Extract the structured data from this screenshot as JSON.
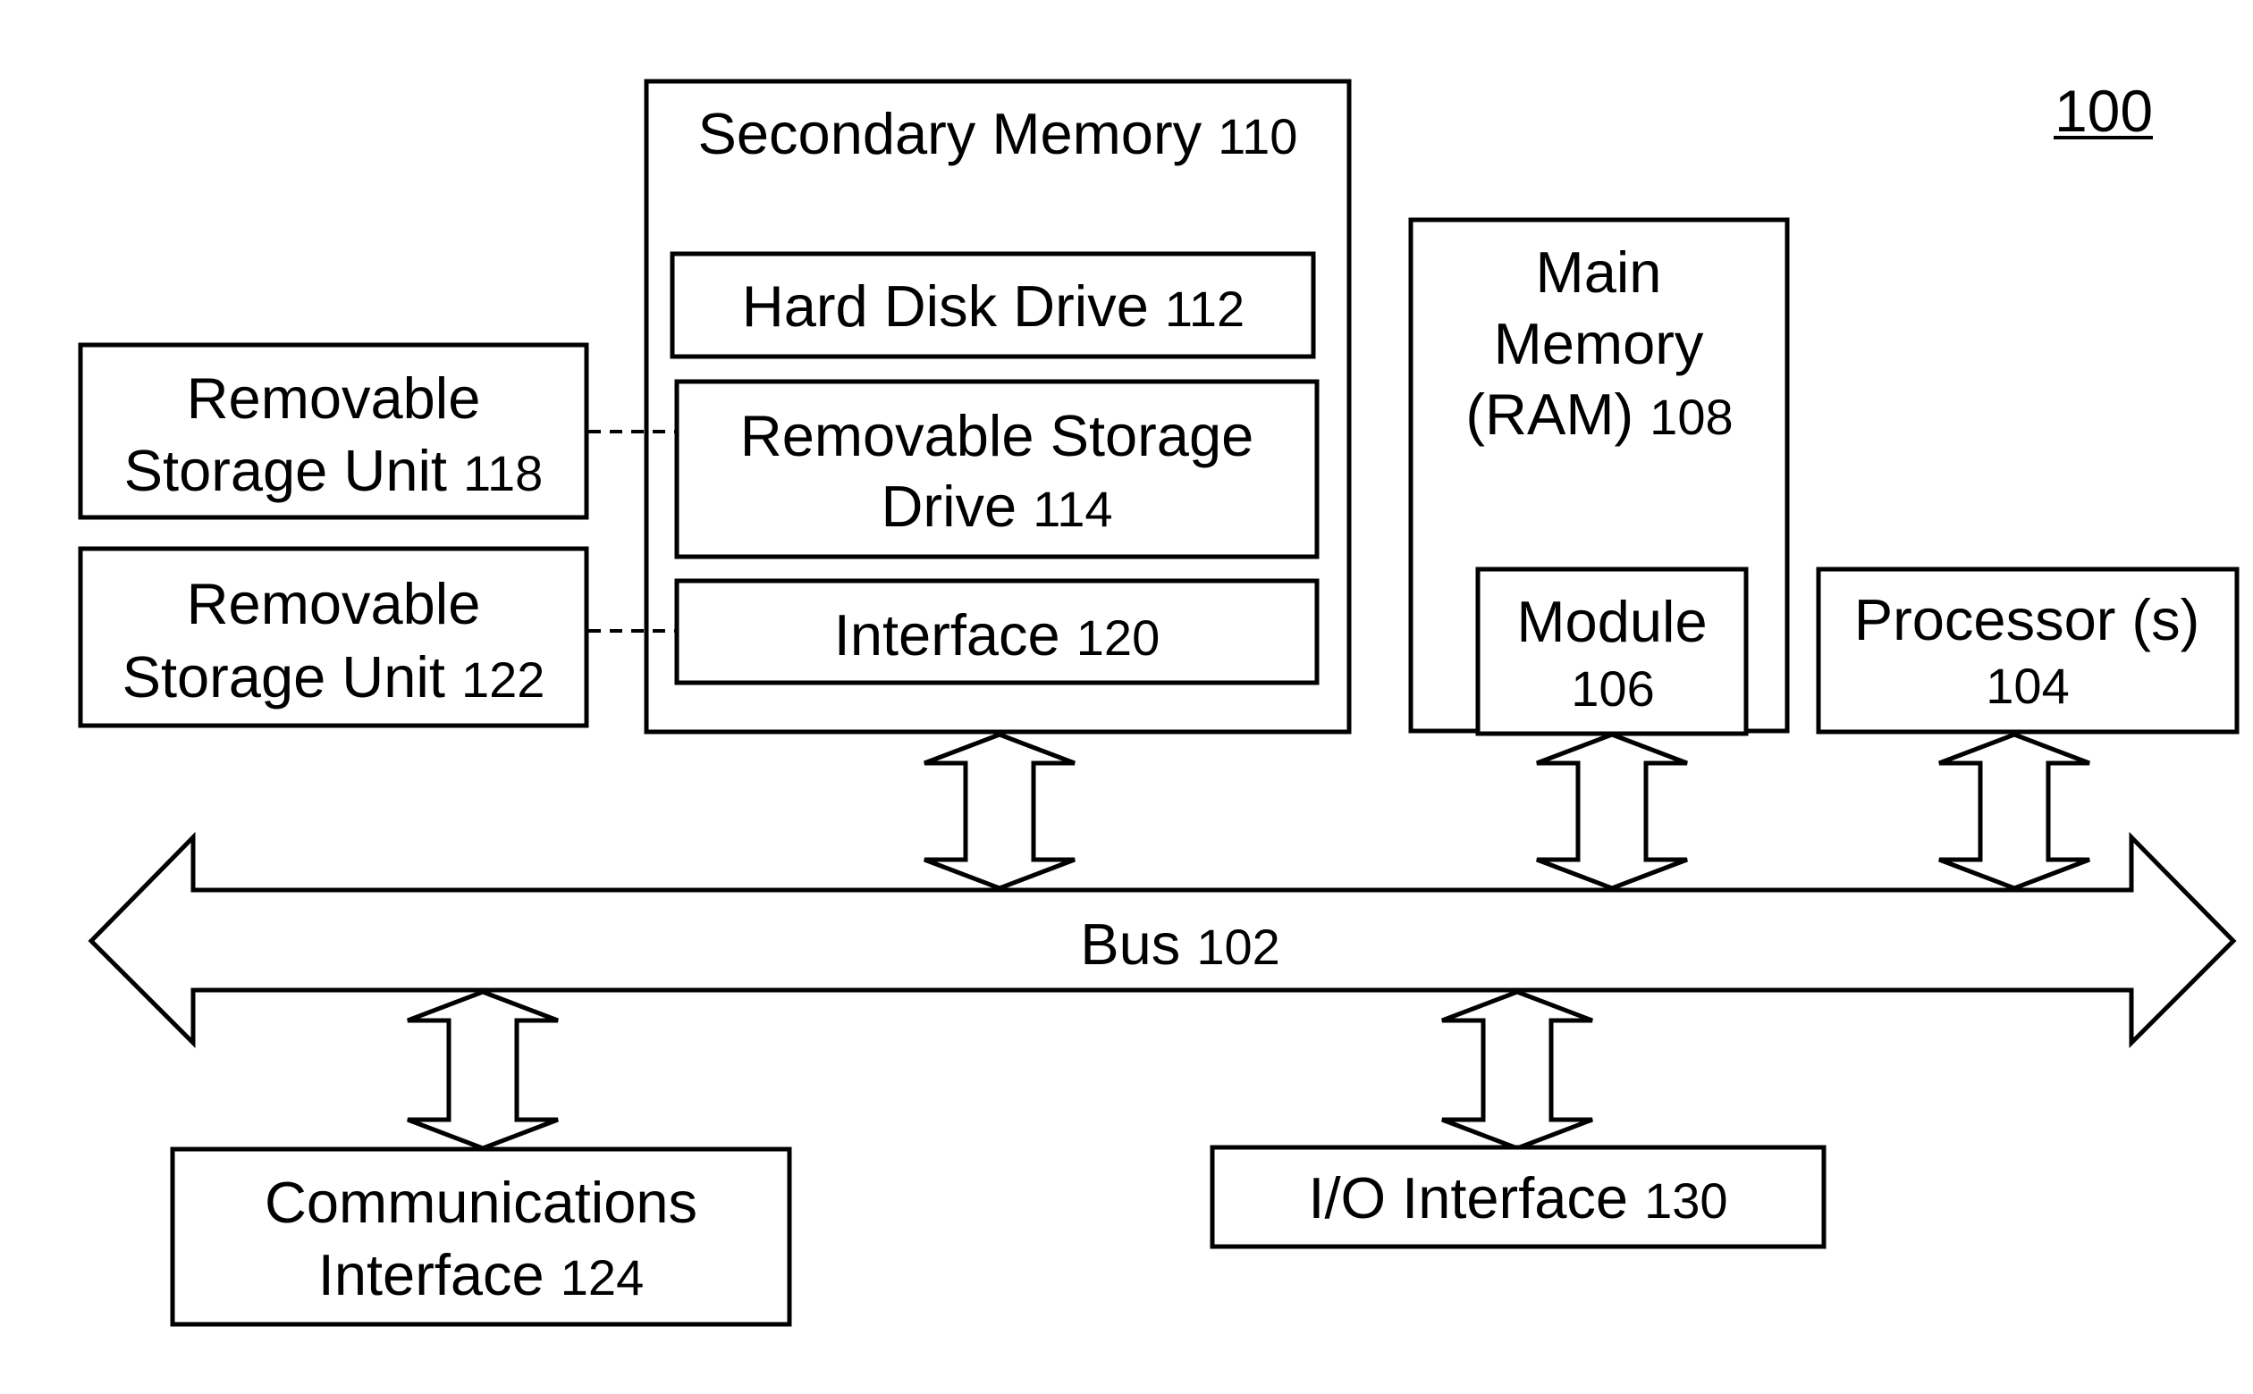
{
  "figure": {
    "reference_number": "100",
    "colors": {
      "stroke": "#000000",
      "background": "#ffffff"
    }
  },
  "components": {
    "secondary_memory": {
      "text": "Secondary Memory",
      "num": "110"
    },
    "hard_disk_drive": {
      "text": "Hard Disk Drive",
      "num": "112"
    },
    "removable_storage_drive": {
      "line1": "Removable Storage",
      "line2_text": "Drive",
      "num": "114"
    },
    "interface": {
      "text": "Interface",
      "num": "120"
    },
    "removable_storage_unit_118": {
      "line1": "Removable",
      "line2_text": "Storage Unit",
      "num": "118"
    },
    "removable_storage_unit_122": {
      "line1": "Removable",
      "line2_text": "Storage Unit",
      "num": "122"
    },
    "main_memory": {
      "line1": "Main",
      "line2": "Memory",
      "line3_text": "(RAM)",
      "num": "108"
    },
    "module": {
      "text": "Module",
      "num": "106"
    },
    "processor": {
      "text": "Processor (s)",
      "num": "104"
    },
    "bus": {
      "text": "Bus",
      "num": "102"
    },
    "communications_interface": {
      "line1": "Communications",
      "line2_text": "Interface",
      "num": "124"
    },
    "io_interface": {
      "text": "I/O Interface",
      "num": "130"
    }
  },
  "connections": [
    {
      "from": "removable_storage_unit_118",
      "to": "removable_storage_drive",
      "style": "dashed"
    },
    {
      "from": "removable_storage_unit_122",
      "to": "interface",
      "style": "dashed"
    },
    {
      "from": "secondary_memory",
      "to": "bus",
      "style": "double-arrow"
    },
    {
      "from": "module",
      "to": "bus",
      "style": "double-arrow"
    },
    {
      "from": "processor",
      "to": "bus",
      "style": "double-arrow"
    },
    {
      "from": "bus",
      "to": "communications_interface",
      "style": "double-arrow"
    },
    {
      "from": "bus",
      "to": "io_interface",
      "style": "double-arrow"
    }
  ]
}
